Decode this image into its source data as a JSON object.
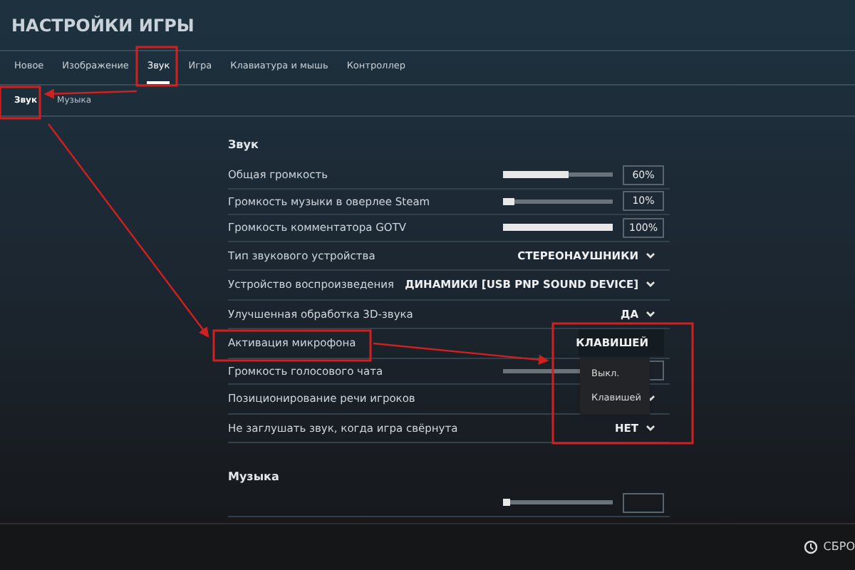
{
  "window": {
    "title": "НАСТРОЙКИ ИГРЫ"
  },
  "tabs": [
    {
      "label": "Новое",
      "selected": false
    },
    {
      "label": "Изображение",
      "selected": false
    },
    {
      "label": "Звук",
      "selected": true
    },
    {
      "label": "Игра",
      "selected": false
    },
    {
      "label": "Клавиатура и мышь",
      "selected": false
    },
    {
      "label": "Контроллер",
      "selected": false
    }
  ],
  "subtabs": [
    {
      "label": "Звук",
      "selected": true
    },
    {
      "label": "Музыка",
      "selected": false
    }
  ],
  "sections": [
    {
      "title": "Звук",
      "rows": [
        {
          "kind": "slider",
          "label": "Общая громкость",
          "level": 0.6,
          "value": "60%"
        },
        {
          "kind": "slider",
          "label": "Громкость музыки в оверлее Steam",
          "level": 0.1,
          "value": "10%"
        },
        {
          "kind": "slider",
          "label": "Громкость комментатора GOTV",
          "level": 1,
          "value": "100%"
        },
        {
          "kind": "dropdown",
          "label": "Тип звукового устройства",
          "value": "СТЕРЕОНАУШНИКИ"
        },
        {
          "kind": "dropdown",
          "label": "Устройство воспроизведения",
          "value": "ДИНАМИКИ [USB PNP SOUND DEVICE]"
        },
        {
          "kind": "dropdown",
          "label": "Улучшенная обработка 3D-звука",
          "value": "ДА"
        },
        {
          "kind": "dropdown",
          "label": "Активация микрофона",
          "value": "КЛАВИШЕЙ",
          "expanded": true,
          "options": [
            "Выкл.",
            "Клавишей"
          ]
        },
        {
          "kind": "slider",
          "label": "Громкость голосового чата"
        },
        {
          "kind": "dropdown",
          "label": "Позиционирование речи игроков"
        },
        {
          "kind": "dropdown",
          "label": "Не заглушать звук, когда игра свёрнута",
          "value": "НЕТ"
        }
      ]
    },
    {
      "title": "Музыка",
      "rows": [
        {
          "kind": "slider",
          "level": 0.07
        }
      ]
    }
  ],
  "footer": {
    "reset_label": "СБРО"
  }
}
